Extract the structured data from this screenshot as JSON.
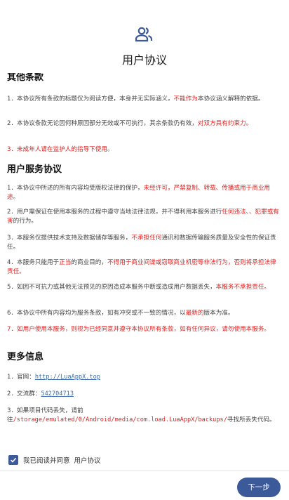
{
  "header": {
    "title": "用户协议",
    "icon": "users-icon"
  },
  "sections": {
    "other": {
      "title": "其他条款",
      "p1": {
        "a": "1．本协议所有条款的标题仅为阅读方便，本身并无实际涵义，",
        "b": "不能作为",
        "c": "本协议涵义解释的依据。"
      },
      "p2": {
        "a": "2．本协议条款无论因何种原因部分无效或不可执行，其余条款仍有效，",
        "b": "对双方具有约束力。"
      },
      "p3": {
        "a": "3．未成年人请在监护人的指导下使用。"
      }
    },
    "service": {
      "title": "用户服务协议",
      "p1": {
        "a": "1．本协议中所述的所有内容均受版权法律的保护，",
        "b": "未经许可，严禁复制、转载、传播或用于商业用途。"
      },
      "p2": {
        "a": "2．用户需保证在使用本服务的过程中遵守当地法律法规，并不得利用本服务进行",
        "b": "任何违法、、犯罪或有害",
        "c": "的行为。"
      },
      "p3": {
        "a": "3．本服务仅提供技术支持及数据储存等服务，",
        "b": "不承担任何",
        "c": "通讯和数据传输服务质量及安全性的保证责任。"
      },
      "p4": {
        "a": "4．本服务只能用于",
        "b": "正当",
        "c": "的商业目的，",
        "d": "不得用于商业间谍或窃取商业机密等非法行为，否则将承担法律责任。"
      },
      "p5": {
        "a": "5．如因不可抗力或其他无法预见的原因造成本服务中断或造成用户数据丢失，",
        "b": "本服务不承担责任。"
      },
      "p6": {
        "a": "6．本协议中所有内容均为服务条款，如有冲突或不一致的情况，以",
        "b": "最新的",
        "c": "版本为准。"
      },
      "p7": {
        "a": "7．如用户使用本服务，则视为已经同意并遵守本协议所有条款，如有任何异议，请勿使用本服务。"
      }
    },
    "more": {
      "title": "更多信息",
      "website_prefix": "1．官网：",
      "website_url": "http://LuaAppX.top",
      "group_prefix": "2．交流群：",
      "group_id": "542704713",
      "p3": {
        "a": "3．如果项目代码丢失，请前往",
        "b": "/storage/emulated/0/Android/media/com.load.LuaAppX/backups/",
        "c": "寻找所丢失代码。"
      }
    }
  },
  "agree": {
    "text": "我已阅读并同意",
    "link": "用户协议",
    "checked": true
  },
  "footer": {
    "next_label": "下一步"
  },
  "colors": {
    "accent": "#3c5a99",
    "warning": "#e02020",
    "link": "#3a6db0"
  }
}
